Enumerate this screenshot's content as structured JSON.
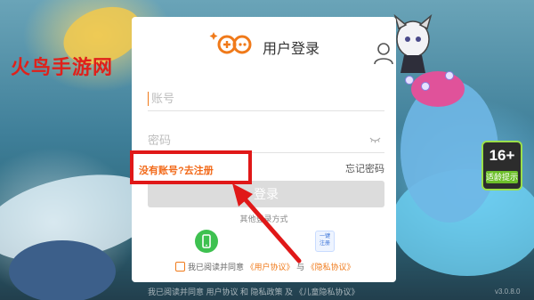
{
  "watermark": "火鸟手游网",
  "dialog": {
    "title": "用户登录",
    "account_placeholder": "账号",
    "password_placeholder": "密码",
    "register_link": "没有账号?去注册",
    "forgot_link": "忘记密码",
    "login_button": "登录",
    "other_methods": "其他登录方式",
    "quick_register_line1": "一键",
    "quick_register_line2": "注册",
    "agree_prefix": "我已阅读并同意",
    "user_agreement": "《用户协议》",
    "and": "与",
    "privacy_policy": "《隐私协议》"
  },
  "age_badge": {
    "number": "16+",
    "label": "适龄提示"
  },
  "footer": "我已阅读并同意 用户协议 和 隐私政策 及 《儿童隐私协议》",
  "version": "v3.0.8.0",
  "colors": {
    "accent": "#f07a1a",
    "annotation": "#e01818",
    "phone": "#3ec150"
  }
}
